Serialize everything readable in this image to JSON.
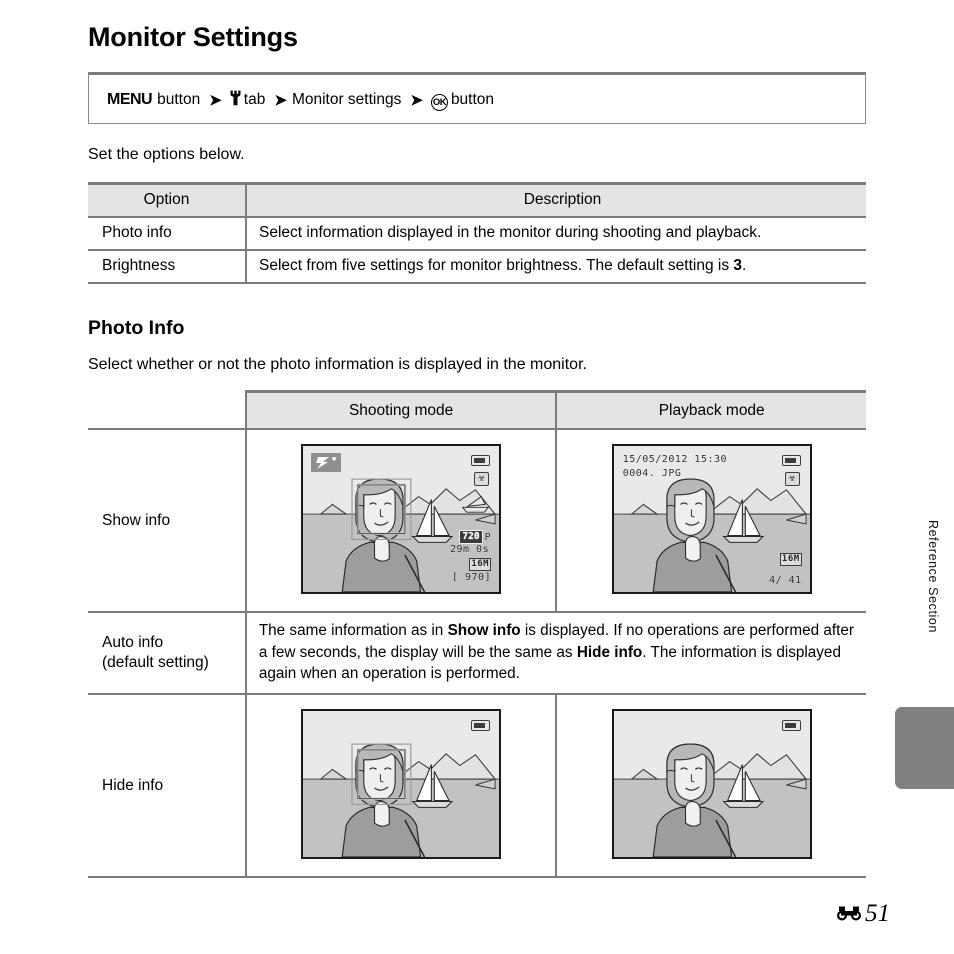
{
  "page": {
    "title": "Monitor Settings",
    "nav_path": {
      "menu_label": "MENU",
      "button_word_1": "button",
      "arrow": "➜",
      "wrench_icon": "ᐳ",
      "tab_word": "tab",
      "middle_item": "Monitor settings",
      "ok_label": "OK",
      "button_word_2": "button"
    },
    "intro": "Set the options below.",
    "footer": {
      "section_marker": "E",
      "page_number": "51"
    },
    "side_tab_label": "Reference Section"
  },
  "options_table": {
    "headers": [
      "Option",
      "Description"
    ],
    "rows": [
      {
        "option": "Photo info",
        "description": "Select information displayed in the monitor during shooting and playback."
      },
      {
        "option": "Brightness",
        "description_prefix": "Select from five settings for monitor brightness. The default setting is ",
        "description_bold": "3",
        "description_suffix": "."
      }
    ]
  },
  "photo_info": {
    "heading": "Photo Info",
    "subtitle": "Select whether or not the photo information is displayed in the monitor.",
    "headers": [
      "Shooting mode",
      "Playback mode"
    ],
    "rows": [
      {
        "label": "Show info",
        "type": "images"
      },
      {
        "label_line1": "Auto info",
        "label_line2": "(default setting)",
        "type": "text",
        "text_part_1": "The same information as in ",
        "text_bold_1": "Show info",
        "text_part_2": " is displayed. If no operations are performed after a few seconds, the display will be the same as ",
        "text_bold_2": "Hide info",
        "text_part_3": ". The information is displayed again when an operation is performed."
      },
      {
        "label": "Hide info",
        "type": "images"
      }
    ]
  },
  "screens": {
    "show_shooting": {
      "scene_icon": "scene-mode-icon",
      "battery_icon": "battery-icon",
      "vr_icon": "vibration-reduction-icon",
      "movie_size": "720",
      "movie_suffix": "P",
      "record_time": "29m 0s",
      "image_size": "16M",
      "shots_remaining": "[ 970]"
    },
    "show_playback": {
      "date": "15/05/2012  15:30",
      "filename": "0004. JPG",
      "battery_icon": "battery-icon",
      "vr_icon": "vibration-reduction-icon",
      "image_size": "16M",
      "frame_counter": "4/   41"
    },
    "hide_shooting": {
      "battery_icon": "battery-icon"
    },
    "hide_playback": {
      "battery_icon": "battery-icon"
    }
  },
  "colors": {
    "rule": "#7c7c7c",
    "header_fill": "#e4e4e4",
    "side_tab": "#808080",
    "screen_sky": "#e9e9e9",
    "screen_sea": "#c2c2c2"
  }
}
